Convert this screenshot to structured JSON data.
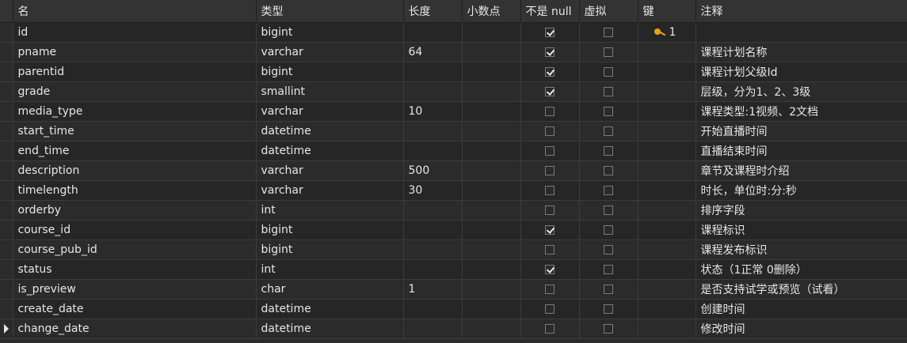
{
  "headers": {
    "name": "名",
    "type": "类型",
    "length": "长度",
    "decimals": "小数点",
    "not_null": "不是 null",
    "virtual": "虚拟",
    "key": "键",
    "comment": "注释"
  },
  "rows": [
    {
      "name": "id",
      "type": "bigint",
      "length": "",
      "decimals": "",
      "not_null": true,
      "virtual": false,
      "key": "1",
      "comment": ""
    },
    {
      "name": "pname",
      "type": "varchar",
      "length": "64",
      "decimals": "",
      "not_null": true,
      "virtual": false,
      "key": "",
      "comment": "课程计划名称"
    },
    {
      "name": "parentid",
      "type": "bigint",
      "length": "",
      "decimals": "",
      "not_null": true,
      "virtual": false,
      "key": "",
      "comment": "课程计划父级Id"
    },
    {
      "name": "grade",
      "type": "smallint",
      "length": "",
      "decimals": "",
      "not_null": true,
      "virtual": false,
      "key": "",
      "comment": "层级，分为1、2、3级"
    },
    {
      "name": "media_type",
      "type": "varchar",
      "length": "10",
      "decimals": "",
      "not_null": false,
      "virtual": false,
      "key": "",
      "comment": "课程类型:1视频、2文档"
    },
    {
      "name": "start_time",
      "type": "datetime",
      "length": "",
      "decimals": "",
      "not_null": false,
      "virtual": false,
      "key": "",
      "comment": "开始直播时间"
    },
    {
      "name": "end_time",
      "type": "datetime",
      "length": "",
      "decimals": "",
      "not_null": false,
      "virtual": false,
      "key": "",
      "comment": "直播结束时间"
    },
    {
      "name": "description",
      "type": "varchar",
      "length": "500",
      "decimals": "",
      "not_null": false,
      "virtual": false,
      "key": "",
      "comment": "章节及课程时介绍"
    },
    {
      "name": "timelength",
      "type": "varchar",
      "length": "30",
      "decimals": "",
      "not_null": false,
      "virtual": false,
      "key": "",
      "comment": "时长，单位时:分:秒"
    },
    {
      "name": "orderby",
      "type": "int",
      "length": "",
      "decimals": "",
      "not_null": false,
      "virtual": false,
      "key": "",
      "comment": "排序字段"
    },
    {
      "name": "course_id",
      "type": "bigint",
      "length": "",
      "decimals": "",
      "not_null": true,
      "virtual": false,
      "key": "",
      "comment": "课程标识"
    },
    {
      "name": "course_pub_id",
      "type": "bigint",
      "length": "",
      "decimals": "",
      "not_null": false,
      "virtual": false,
      "key": "",
      "comment": "课程发布标识"
    },
    {
      "name": "status",
      "type": "int",
      "length": "",
      "decimals": "",
      "not_null": true,
      "virtual": false,
      "key": "",
      "comment": "状态（1正常  0删除）"
    },
    {
      "name": "is_preview",
      "type": "char",
      "length": "1",
      "decimals": "",
      "not_null": false,
      "virtual": false,
      "key": "",
      "comment": "是否支持试学或预览（试看）"
    },
    {
      "name": "create_date",
      "type": "datetime",
      "length": "",
      "decimals": "",
      "not_null": false,
      "virtual": false,
      "key": "",
      "comment": "创建时间"
    },
    {
      "name": "change_date",
      "type": "datetime",
      "length": "",
      "decimals": "",
      "not_null": false,
      "virtual": false,
      "key": "",
      "comment": "修改时间"
    }
  ],
  "current_row_index": 15,
  "colors": {
    "background": "#2b2b2b",
    "header_bg": "#333333",
    "key_icon": "#e8a316",
    "text": "#e6e6e6"
  }
}
